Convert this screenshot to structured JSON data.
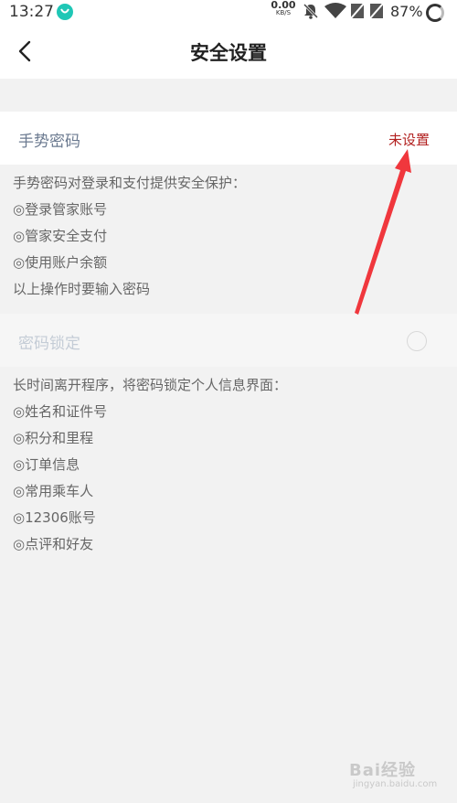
{
  "status_bar": {
    "time": "13:27",
    "net_speed": "0.00",
    "net_unit": "KB/S",
    "battery": "87%",
    "icons": [
      "app-notification-icon",
      "mute-bell-icon",
      "wifi-icon",
      "no-sim-icon",
      "no-sim-icon",
      "battery-ring-icon"
    ]
  },
  "header": {
    "title": "安全设置",
    "back_icon": "chevron-left-icon"
  },
  "gesture_password": {
    "label": "手势密码",
    "value": "未设置",
    "value_color": "#b2201f"
  },
  "gesture_desc": [
    "手势密码对登录和支付提供安全保护：",
    "◎登录管家账号",
    "◎管家安全支付",
    "◎使用账户余额",
    "以上操作时要输入密码"
  ],
  "password_lock": {
    "label": "密码锁定",
    "enabled": false
  },
  "lock_desc": [
    "长时间离开程序，将密码锁定个人信息界面：",
    "◎姓名和证件号",
    "◎积分和里程",
    "◎订单信息",
    "◎常用乘车人",
    "◎12306账号",
    "◎点评和好友"
  ],
  "annotation": {
    "arrow_color": "#f0373d"
  },
  "watermark": {
    "top": "Bai经验",
    "bottom": "jingyan.baidu.com"
  }
}
